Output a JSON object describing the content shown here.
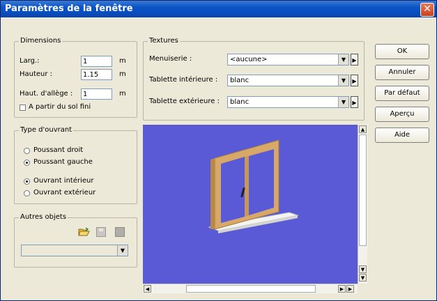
{
  "window": {
    "title": "Paramètres de la fenêtre",
    "close_glyph": "✕"
  },
  "dimensions": {
    "title": "Dimensions",
    "larg_label": "Larg.:",
    "larg_value": "1",
    "larg_unit": "m",
    "hauteur_label": "Hauteur :",
    "hauteur_value": "1.15",
    "hauteur_unit": "m",
    "allege_label": "Haut. d'allège :",
    "allege_value": "1",
    "allege_unit": "m",
    "sol_fini_label": "A partir du sol fini"
  },
  "ouvrant": {
    "title": "Type d'ouvrant",
    "options": [
      "Poussant droit",
      "Poussant gauche",
      "Ouvrant intérieur",
      "Ouvrant extérieur"
    ]
  },
  "autres": {
    "title": "Autres objets"
  },
  "textures": {
    "title": "Textures",
    "menuiserie_label": "Menuiserie :",
    "menuiserie_value": "<aucune>",
    "tab_int_label": "Tablette intérieure :",
    "tab_int_value": "blanc",
    "tab_ext_label": "Tablette extérieure :",
    "tab_ext_value": "blanc"
  },
  "buttons": {
    "ok": "OK",
    "annuler": "Annuler",
    "defaut": "Par défaut",
    "apercu": "Aperçu",
    "aide": "Aide"
  },
  "colors": {
    "viewport_bg": "#5a5ad6",
    "frame_wood": "#d8a868",
    "sill": "#f4f4f0"
  }
}
